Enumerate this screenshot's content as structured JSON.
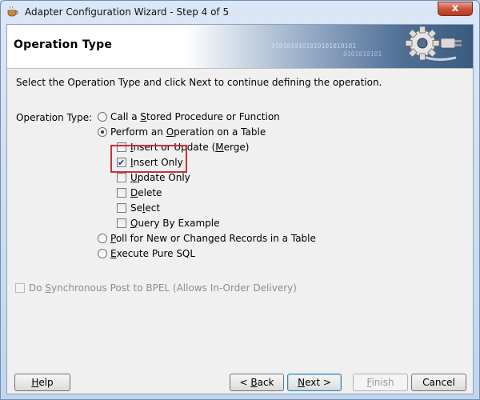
{
  "window": {
    "title": "Adapter Configuration Wizard - Step 4 of 5",
    "close_symbol": "x"
  },
  "header": {
    "title": "Operation Type",
    "binary_1": "0101010101010101010101",
    "binary_2": "0101010101"
  },
  "instructions": "Select the Operation Type and click Next to continue defining the operation.",
  "operation_type": {
    "label": "Operation Type:",
    "options": {
      "stored_proc": {
        "label_pre": "Call a ",
        "label_key": "S",
        "label_post": "tored Procedure or Function",
        "selected": false
      },
      "table_op": {
        "label_pre": "Perform an ",
        "label_key": "O",
        "label_post": "peration on a Table",
        "selected": true
      },
      "poll": {
        "label_pre": "",
        "label_key": "P",
        "label_post": "oll for New or Changed Records in a Table",
        "selected": false
      },
      "pure_sql": {
        "label_pre": "",
        "label_key": "E",
        "label_post": "xecute Pure SQL",
        "selected": false
      }
    },
    "table_ops": {
      "merge": {
        "label_pre": "",
        "label_key": "I",
        "label_post": "nsert or Update (",
        "label_key2": "M",
        "label_post2": "erge)",
        "checked": false
      },
      "insert": {
        "label_pre": "",
        "label_key": "I",
        "label_post": "nsert Only",
        "checked": true
      },
      "update": {
        "label_pre": "",
        "label_key": "U",
        "label_post": "pdate Only",
        "checked": false
      },
      "delete": {
        "label_pre": "",
        "label_key": "D",
        "label_post": "elete",
        "checked": false
      },
      "select": {
        "label_pre": "Se",
        "label_key": "l",
        "label_post": "ect",
        "checked": false
      },
      "qbe": {
        "label_pre": "",
        "label_key": "Q",
        "label_post": "uery By Example",
        "checked": false
      }
    }
  },
  "sync_post": {
    "label_pre": "Do ",
    "label_key": "S",
    "label_post": "ynchronous Post to BPEL (Allows In-Order Delivery)",
    "checked": false,
    "enabled": false
  },
  "buttons": {
    "help": {
      "label_key": "H",
      "label_post": "elp"
    },
    "back": {
      "label_pre": "< ",
      "label_key": "B",
      "label_post": "ack"
    },
    "next": {
      "label_key": "N",
      "label_post": "ext >"
    },
    "finish": {
      "label_key": "F",
      "label_post": "inish"
    },
    "cancel": {
      "label": "Cancel"
    }
  },
  "colors": {
    "highlight": "#c8303a",
    "header_blue": "#3e5f86"
  }
}
